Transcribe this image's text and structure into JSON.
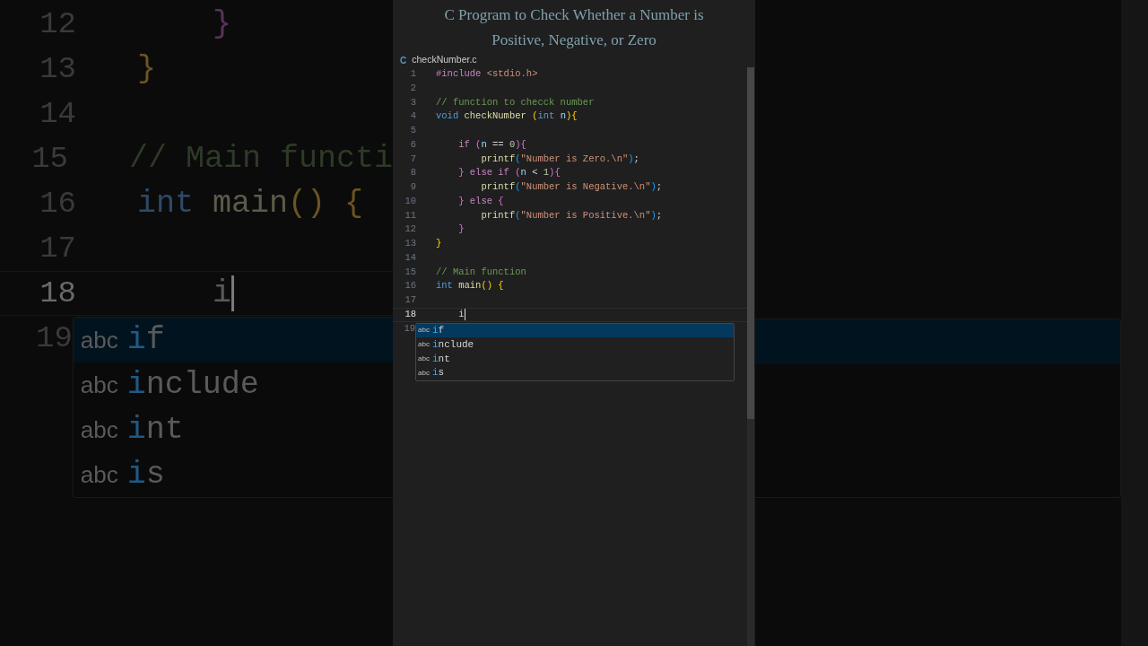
{
  "background_zoom": {
    "lines": [
      {
        "number": "12",
        "cursor": false,
        "tokens": [
          {
            "text": "    }",
            "kind": "brace2"
          }
        ]
      },
      {
        "number": "13",
        "cursor": false,
        "tokens": [
          {
            "text": "}",
            "kind": "brace1"
          }
        ]
      },
      {
        "number": "14",
        "cursor": false
      },
      {
        "number": "15",
        "cursor": false,
        "tokens": [
          {
            "text": "// Main functi",
            "kind": "comment"
          }
        ]
      },
      {
        "number": "16",
        "cursor": false,
        "tokens": [
          {
            "text": "int ",
            "kind": "keyword"
          },
          {
            "text": "main",
            "kind": "function"
          },
          {
            "text": "() {",
            "kind": "brace1"
          }
        ]
      },
      {
        "number": "17",
        "cursor": false
      },
      {
        "number": "18",
        "cursor": true,
        "tokens": [
          {
            "text": "    i",
            "kind": "plain"
          }
        ]
      },
      {
        "number": "19",
        "cursor": false
      }
    ],
    "suggestions": [
      {
        "tag": "abc",
        "prefix": "i",
        "rest": "f",
        "selected": true
      },
      {
        "tag": "abc",
        "prefix": "i",
        "rest": "nclude",
        "selected": false
      },
      {
        "tag": "abc",
        "prefix": "i",
        "rest": "nt",
        "selected": false
      },
      {
        "tag": "abc",
        "prefix": "i",
        "rest": "s",
        "selected": false
      }
    ]
  },
  "video_title": "C Program to Check Whether a Number is Positive, Negative, or Zero",
  "editor": {
    "tab": {
      "icon": "C",
      "label": "checkNumber.c"
    },
    "lines": [
      {
        "number": "1",
        "cursor": false,
        "tokens": [
          {
            "text": "#include ",
            "kind": "control"
          },
          {
            "text": "<stdio.h>",
            "kind": "string"
          }
        ]
      },
      {
        "number": "2",
        "cursor": false
      },
      {
        "number": "3",
        "cursor": false,
        "tokens": [
          {
            "text": "// function to checck number",
            "kind": "comment"
          }
        ]
      },
      {
        "number": "4",
        "cursor": false,
        "tokens": [
          {
            "text": "void ",
            "kind": "keyword"
          },
          {
            "text": "checkNumber ",
            "kind": "function"
          },
          {
            "text": "(",
            "kind": "brace1"
          },
          {
            "text": "int ",
            "kind": "keyword"
          },
          {
            "text": "n",
            "kind": "variable"
          },
          {
            "text": "){",
            "kind": "brace1"
          }
        ]
      },
      {
        "number": "5",
        "cursor": false
      },
      {
        "number": "6",
        "cursor": false,
        "tokens": [
          {
            "text": "    if ",
            "kind": "control"
          },
          {
            "text": "(",
            "kind": "brace2"
          },
          {
            "text": "n",
            "kind": "variable"
          },
          {
            "text": " == ",
            "kind": "plain"
          },
          {
            "text": "0",
            "kind": "number"
          },
          {
            "text": "){",
            "kind": "brace2"
          }
        ]
      },
      {
        "number": "7",
        "cursor": false,
        "tokens": [
          {
            "text": "        printf",
            "kind": "function"
          },
          {
            "text": "(",
            "kind": "brace3"
          },
          {
            "text": "\"Number is Zero.\\n\"",
            "kind": "string"
          },
          {
            "text": ")",
            "kind": "brace3"
          },
          {
            "text": ";",
            "kind": "plain"
          }
        ]
      },
      {
        "number": "8",
        "cursor": false,
        "tokens": [
          {
            "text": "    } ",
            "kind": "brace2"
          },
          {
            "text": "else if ",
            "kind": "control"
          },
          {
            "text": "(",
            "kind": "brace2"
          },
          {
            "text": "n",
            "kind": "variable"
          },
          {
            "text": " < ",
            "kind": "plain"
          },
          {
            "text": "1",
            "kind": "number"
          },
          {
            "text": "){",
            "kind": "brace2"
          }
        ]
      },
      {
        "number": "9",
        "cursor": false,
        "tokens": [
          {
            "text": "        printf",
            "kind": "function"
          },
          {
            "text": "(",
            "kind": "brace3"
          },
          {
            "text": "\"Number is Negative.\\n\"",
            "kind": "string"
          },
          {
            "text": ")",
            "kind": "brace3"
          },
          {
            "text": ";",
            "kind": "plain"
          }
        ]
      },
      {
        "number": "10",
        "cursor": false,
        "tokens": [
          {
            "text": "    } ",
            "kind": "brace2"
          },
          {
            "text": "else ",
            "kind": "control"
          },
          {
            "text": "{",
            "kind": "brace2"
          }
        ]
      },
      {
        "number": "11",
        "cursor": false,
        "tokens": [
          {
            "text": "        printf",
            "kind": "function"
          },
          {
            "text": "(",
            "kind": "brace3"
          },
          {
            "text": "\"Number is Positive.\\n\"",
            "kind": "string"
          },
          {
            "text": ")",
            "kind": "brace3"
          },
          {
            "text": ";",
            "kind": "plain"
          }
        ]
      },
      {
        "number": "12",
        "cursor": false,
        "tokens": [
          {
            "text": "    }",
            "kind": "brace2"
          }
        ]
      },
      {
        "number": "13",
        "cursor": false,
        "tokens": [
          {
            "text": "}",
            "kind": "brace1"
          }
        ]
      },
      {
        "number": "14",
        "cursor": false
      },
      {
        "number": "15",
        "cursor": false,
        "tokens": [
          {
            "text": "// Main function",
            "kind": "comment"
          }
        ]
      },
      {
        "number": "16",
        "cursor": false,
        "tokens": [
          {
            "text": "int ",
            "kind": "keyword"
          },
          {
            "text": "main",
            "kind": "function"
          },
          {
            "text": "() {",
            "kind": "brace1"
          }
        ]
      },
      {
        "number": "17",
        "cursor": false
      },
      {
        "number": "18",
        "cursor": true,
        "tokens": [
          {
            "text": "    i",
            "kind": "plain"
          }
        ]
      },
      {
        "number": "19",
        "cursor": false
      }
    ],
    "suggestions": [
      {
        "tag": "abc",
        "prefix": "i",
        "rest": "f",
        "selected": true
      },
      {
        "tag": "abc",
        "prefix": "i",
        "rest": "nclude",
        "selected": false
      },
      {
        "tag": "abc",
        "prefix": "i",
        "rest": "nt",
        "selected": false
      },
      {
        "tag": "abc",
        "prefix": "i",
        "rest": "s",
        "selected": false
      }
    ]
  }
}
